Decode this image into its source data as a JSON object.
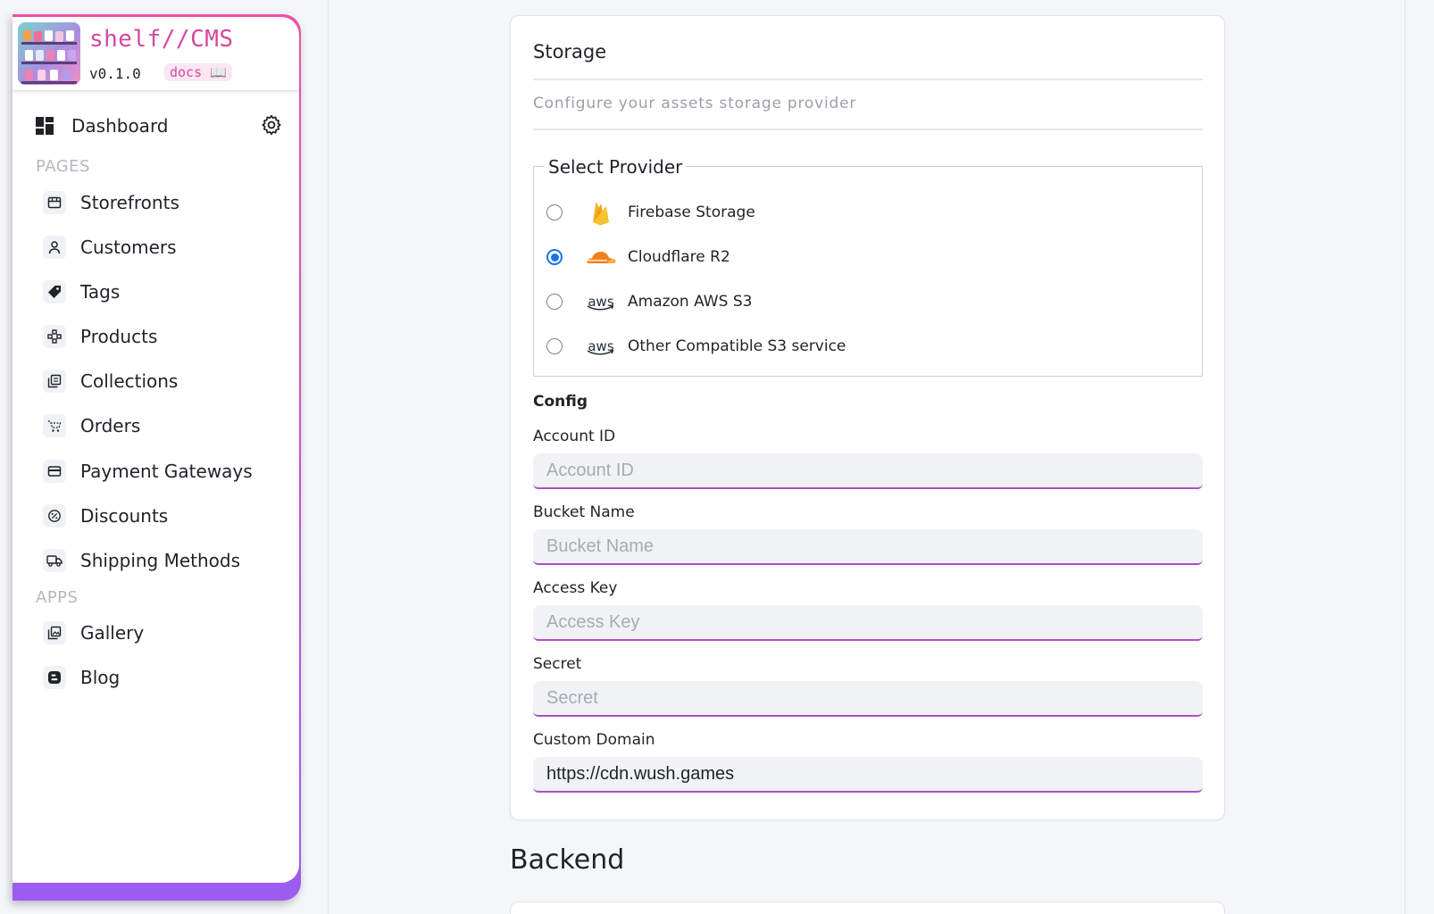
{
  "brand": {
    "name": "shelf//CMS",
    "version": "v0.1.0",
    "docs_label": "docs 📖"
  },
  "sidebar": {
    "dashboard_label": "Dashboard",
    "pages_section": "PAGES",
    "apps_section": "APPS",
    "pages": [
      {
        "label": "Storefronts",
        "icon": "storefront-icon"
      },
      {
        "label": "Customers",
        "icon": "user-icon"
      },
      {
        "label": "Tags",
        "icon": "tag-icon"
      },
      {
        "label": "Products",
        "icon": "products-icon"
      },
      {
        "label": "Collections",
        "icon": "collections-icon"
      },
      {
        "label": "Orders",
        "icon": "cart-icon"
      },
      {
        "label": "Payment Gateways",
        "icon": "credit-card-icon"
      },
      {
        "label": "Discounts",
        "icon": "discount-icon"
      },
      {
        "label": "Shipping Methods",
        "icon": "truck-icon"
      }
    ],
    "apps": [
      {
        "label": "Gallery",
        "icon": "gallery-icon"
      },
      {
        "label": "Blog",
        "icon": "blog-icon"
      }
    ]
  },
  "storage": {
    "title": "Storage",
    "subtitle": "Configure your assets storage provider",
    "select_provider_label": "Select Provider",
    "providers": [
      {
        "label": "Firebase Storage",
        "icon": "firebase-icon",
        "checked": false
      },
      {
        "label": "Cloudflare R2",
        "icon": "cloudflare-icon",
        "checked": true
      },
      {
        "label": "Amazon AWS S3",
        "icon": "aws-icon",
        "checked": false
      },
      {
        "label": "Other Compatible S3 service",
        "icon": "aws-icon",
        "checked": false
      }
    ],
    "aws_text": "aws",
    "config_title": "Config",
    "fields": [
      {
        "label": "Account ID",
        "placeholder": "Account ID",
        "value": ""
      },
      {
        "label": "Bucket Name",
        "placeholder": "Bucket Name",
        "value": ""
      },
      {
        "label": "Access Key",
        "placeholder": "Access Key",
        "value": ""
      },
      {
        "label": "Secret",
        "placeholder": "Secret",
        "value": ""
      },
      {
        "label": "Custom Domain",
        "placeholder": "Custom Domain",
        "value": "https://cdn.wush.games"
      }
    ]
  },
  "backend": {
    "title": "Backend"
  },
  "colors": {
    "brand_pink": "#d6479e",
    "accent_purple": "#b34cc4",
    "radio_blue": "#1a73e8",
    "firebase_orange": "#f6b21a",
    "cloudflare_orange": "#f38020"
  }
}
